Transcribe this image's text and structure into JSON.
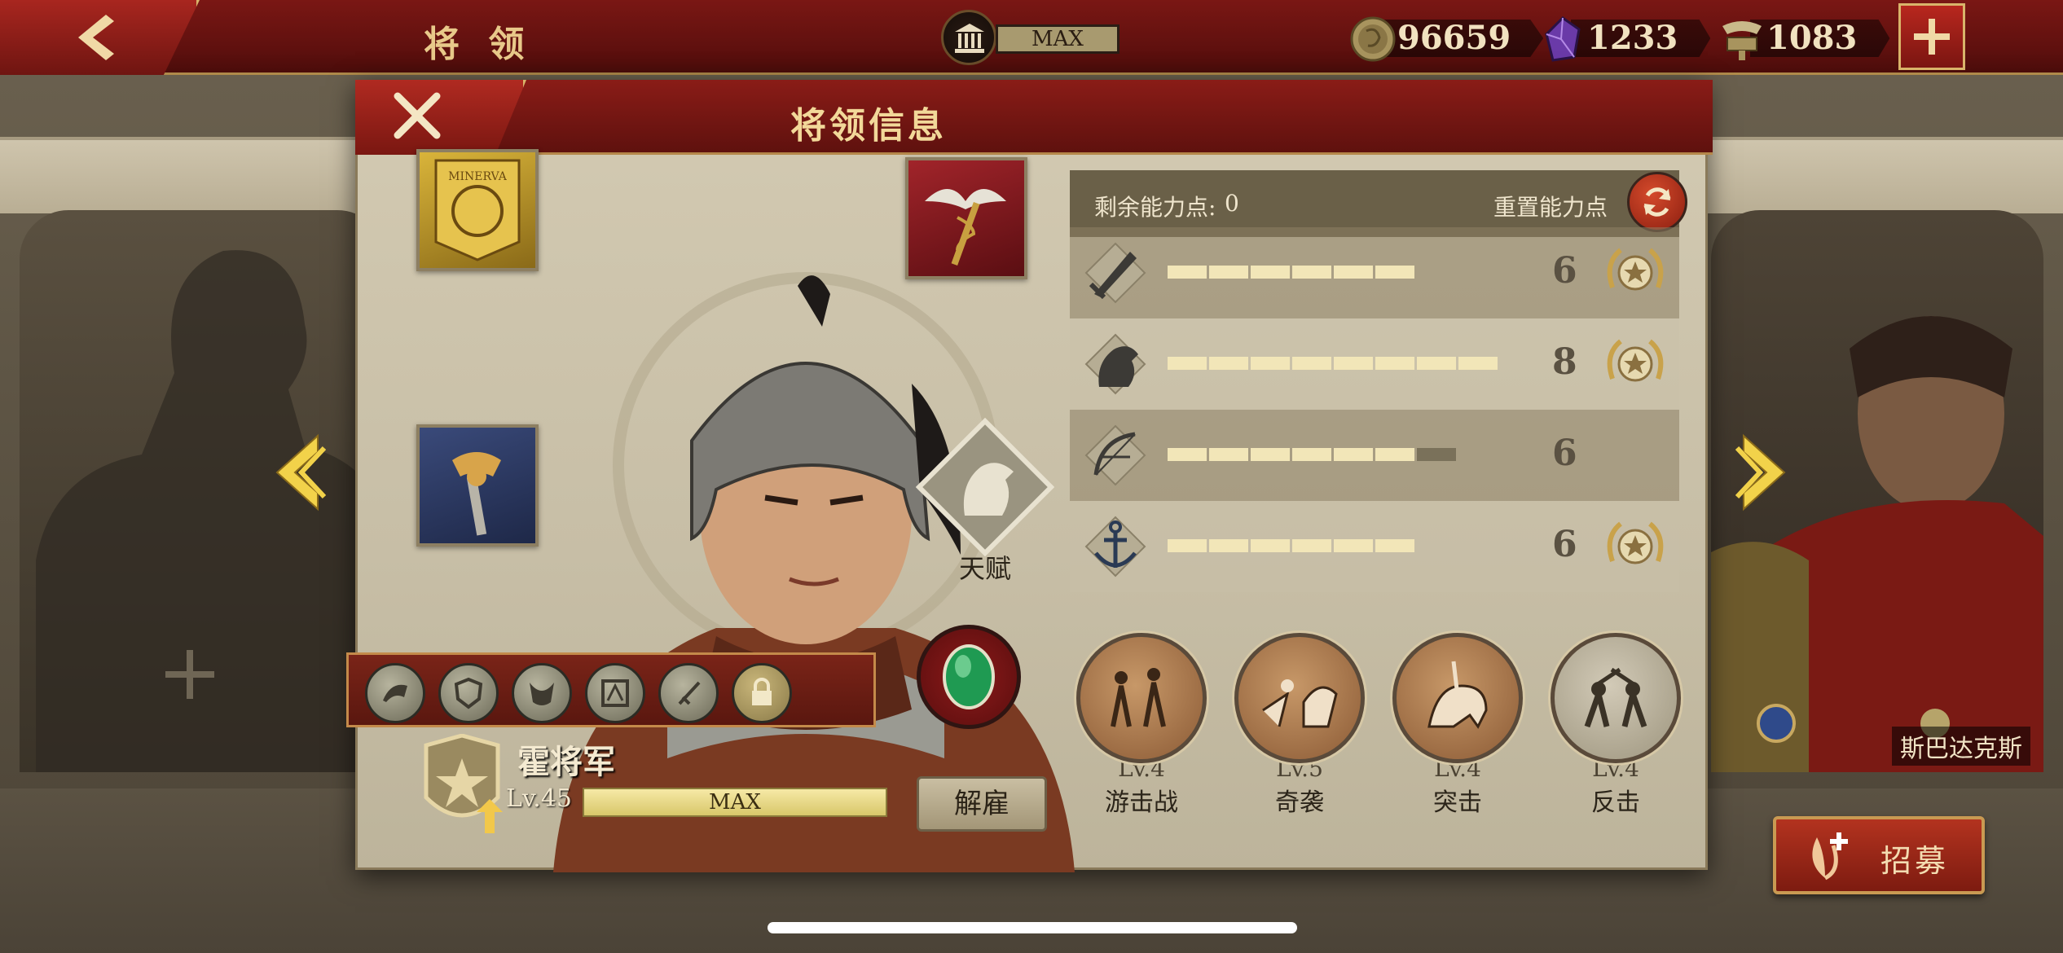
{
  "topbar": {
    "title": "将 领",
    "museum_level": "MAX",
    "resources": [
      {
        "icon": "coin-icon",
        "value": "96659"
      },
      {
        "icon": "crystal-icon",
        "value": "1233"
      },
      {
        "icon": "spqr-eagle-icon",
        "value": "1083"
      }
    ]
  },
  "modal": {
    "title": "将领信息",
    "points_label": "剩余能力点:",
    "points_value": "0",
    "reset_label": "重置能力点",
    "talent_label": "天赋",
    "equipment": [
      {
        "name": "minerva-banner-icon",
        "text": "MINERVA"
      },
      {
        "name": "caduceus-icon"
      },
      {
        "name": "eagle-scepter-icon"
      }
    ],
    "stats": [
      {
        "name": "attack",
        "icon": "sword-icon",
        "value": "6",
        "filled": 6,
        "partial": 0,
        "medal": true
      },
      {
        "name": "cavalry",
        "icon": "horse-icon",
        "value": "8",
        "filled": 8,
        "partial": 0,
        "medal": true
      },
      {
        "name": "archery",
        "icon": "bow-icon",
        "value": "6",
        "filled": 6,
        "partial": 1,
        "medal": false
      },
      {
        "name": "navy",
        "icon": "anchor-icon",
        "value": "6",
        "filled": 6,
        "partial": 0,
        "medal": true
      }
    ],
    "skills": [
      "skill-1-icon",
      "skill-2-icon",
      "skill-3-icon",
      "skill-4-icon",
      "skill-5-icon",
      "lock-icon"
    ],
    "general": {
      "name": "霍将军",
      "level": "Lv.45",
      "exp_text": "MAX",
      "dismiss_label": "解雇"
    },
    "tactics": [
      {
        "level": "Lv.4",
        "name": "游击战"
      },
      {
        "level": "Lv.5",
        "name": "奇袭"
      },
      {
        "level": "Lv.4",
        "name": "突击"
      },
      {
        "level": "Lv.4",
        "name": "反击"
      }
    ]
  },
  "background": {
    "right_general_name": "斯巴达克斯",
    "recruit_label": "招募"
  },
  "colors": {
    "header_red": "#7a1714",
    "gold_trim": "#d8b46a",
    "panel_bg": "#c7bea6",
    "stat_bar": "#f2e6b8"
  }
}
